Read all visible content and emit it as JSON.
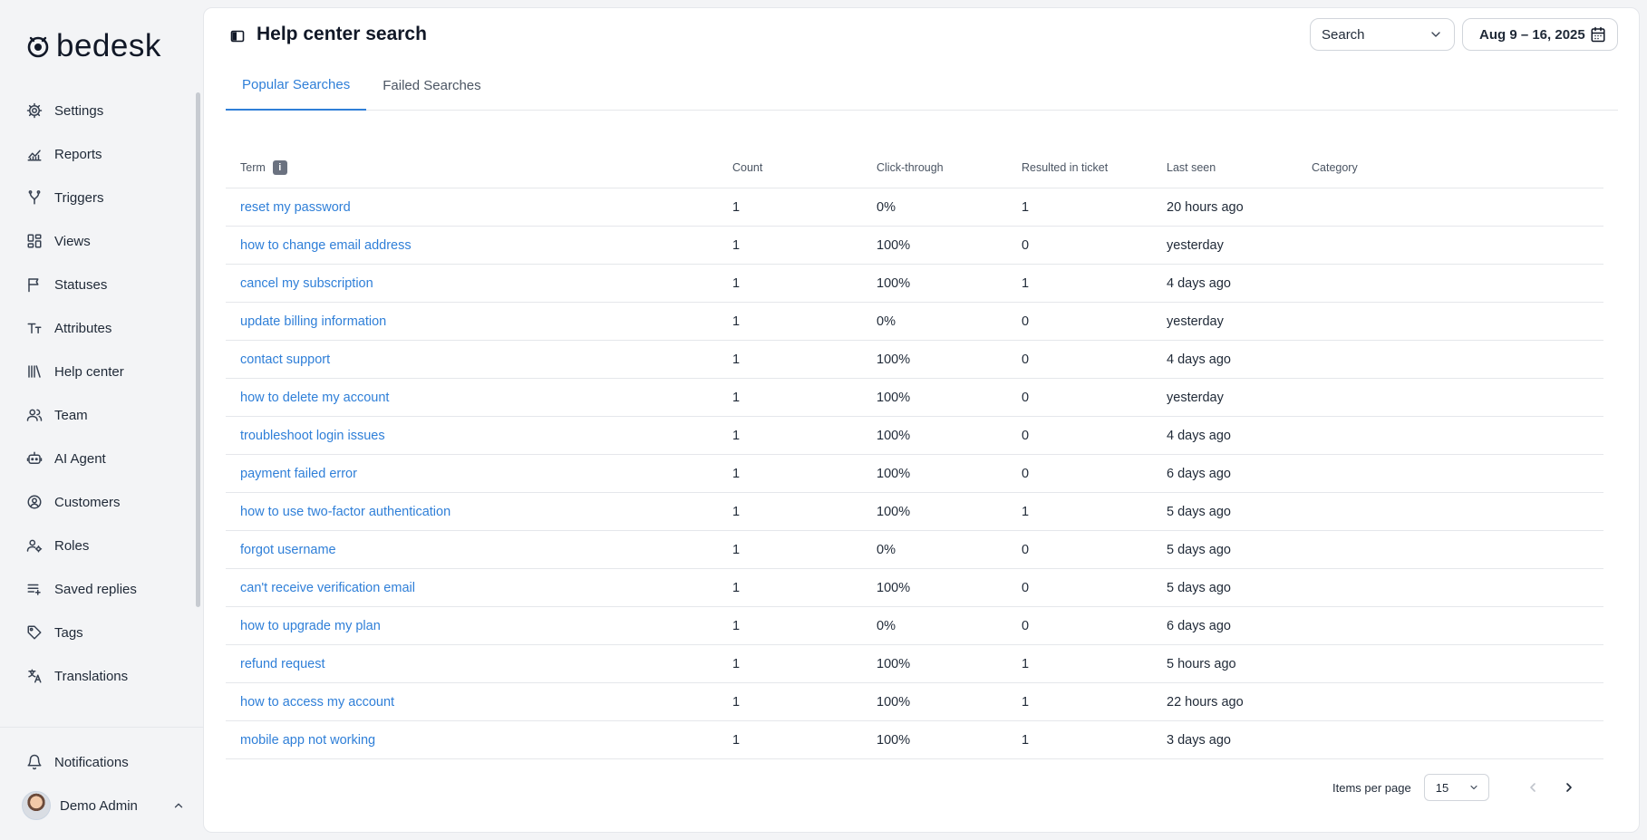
{
  "brand": {
    "name": "bedesk"
  },
  "sidebar": {
    "items": [
      {
        "label": "Settings",
        "icon": "gear-icon"
      },
      {
        "label": "Reports",
        "icon": "chart-icon"
      },
      {
        "label": "Triggers",
        "icon": "branch-icon"
      },
      {
        "label": "Views",
        "icon": "grid-icon"
      },
      {
        "label": "Statuses",
        "icon": "flag-icon"
      },
      {
        "label": "Attributes",
        "icon": "text-size-icon"
      },
      {
        "label": "Help center",
        "icon": "library-icon"
      },
      {
        "label": "Team",
        "icon": "users-icon"
      },
      {
        "label": "AI Agent",
        "icon": "robot-icon"
      },
      {
        "label": "Customers",
        "icon": "user-circle-icon"
      },
      {
        "label": "Roles",
        "icon": "user-gear-icon"
      },
      {
        "label": "Saved replies",
        "icon": "reply-list-icon"
      },
      {
        "label": "Tags",
        "icon": "tag-icon"
      },
      {
        "label": "Translations",
        "icon": "translate-icon"
      }
    ],
    "notifications_label": "Notifications",
    "user_name": "Demo Admin"
  },
  "header": {
    "title": "Help center search",
    "select_value": "Search",
    "date_range": "Aug 9 – 16, 2025"
  },
  "tabs": [
    {
      "label": "Popular Searches",
      "active": true
    },
    {
      "label": "Failed Searches",
      "active": false
    }
  ],
  "table": {
    "columns": [
      "Term",
      "Count",
      "Click-through",
      "Resulted in ticket",
      "Last seen",
      "Category"
    ],
    "rows": [
      {
        "term": "reset my password",
        "count": "1",
        "click": "0%",
        "ticket": "1",
        "last": "20 hours ago",
        "category": ""
      },
      {
        "term": "how to change email address",
        "count": "1",
        "click": "100%",
        "ticket": "0",
        "last": "yesterday",
        "category": ""
      },
      {
        "term": "cancel my subscription",
        "count": "1",
        "click": "100%",
        "ticket": "1",
        "last": "4 days ago",
        "category": ""
      },
      {
        "term": "update billing information",
        "count": "1",
        "click": "0%",
        "ticket": "0",
        "last": "yesterday",
        "category": ""
      },
      {
        "term": "contact support",
        "count": "1",
        "click": "100%",
        "ticket": "0",
        "last": "4 days ago",
        "category": ""
      },
      {
        "term": "how to delete my account",
        "count": "1",
        "click": "100%",
        "ticket": "0",
        "last": "yesterday",
        "category": ""
      },
      {
        "term": "troubleshoot login issues",
        "count": "1",
        "click": "100%",
        "ticket": "0",
        "last": "4 days ago",
        "category": ""
      },
      {
        "term": "payment failed error",
        "count": "1",
        "click": "100%",
        "ticket": "0",
        "last": "6 days ago",
        "category": ""
      },
      {
        "term": "how to use two-factor authentication",
        "count": "1",
        "click": "100%",
        "ticket": "1",
        "last": "5 days ago",
        "category": ""
      },
      {
        "term": "forgot username",
        "count": "1",
        "click": "0%",
        "ticket": "0",
        "last": "5 days ago",
        "category": ""
      },
      {
        "term": "can't receive verification email",
        "count": "1",
        "click": "100%",
        "ticket": "0",
        "last": "5 days ago",
        "category": ""
      },
      {
        "term": "how to upgrade my plan",
        "count": "1",
        "click": "0%",
        "ticket": "0",
        "last": "6 days ago",
        "category": ""
      },
      {
        "term": "refund request",
        "count": "1",
        "click": "100%",
        "ticket": "1",
        "last": "5 hours ago",
        "category": ""
      },
      {
        "term": "how to access my account",
        "count": "1",
        "click": "100%",
        "ticket": "1",
        "last": "22 hours ago",
        "category": ""
      },
      {
        "term": "mobile app not working",
        "count": "1",
        "click": "100%",
        "ticket": "1",
        "last": "3 days ago",
        "category": ""
      }
    ]
  },
  "pagination": {
    "items_per_page_label": "Items per page",
    "items_per_page": "15"
  },
  "colors": {
    "accent": "#2f7fd8"
  }
}
